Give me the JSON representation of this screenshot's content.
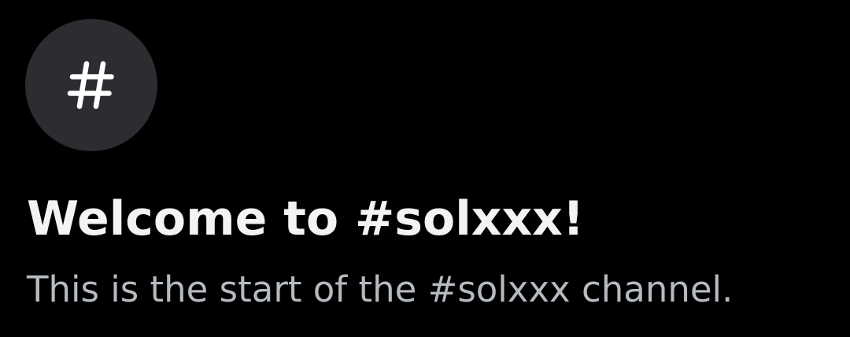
{
  "channel": {
    "icon": "hashtag-icon",
    "name": "solxxx"
  },
  "welcome": {
    "title": "Welcome to #solxxx!",
    "subtitle": "This is the start of the #solxxx channel."
  },
  "colors": {
    "background": "#000000",
    "icon_circle": "#2b2d31",
    "icon_glyph": "#ffffff",
    "title": "#f2f3f5",
    "subtitle": "#b5bac1"
  }
}
